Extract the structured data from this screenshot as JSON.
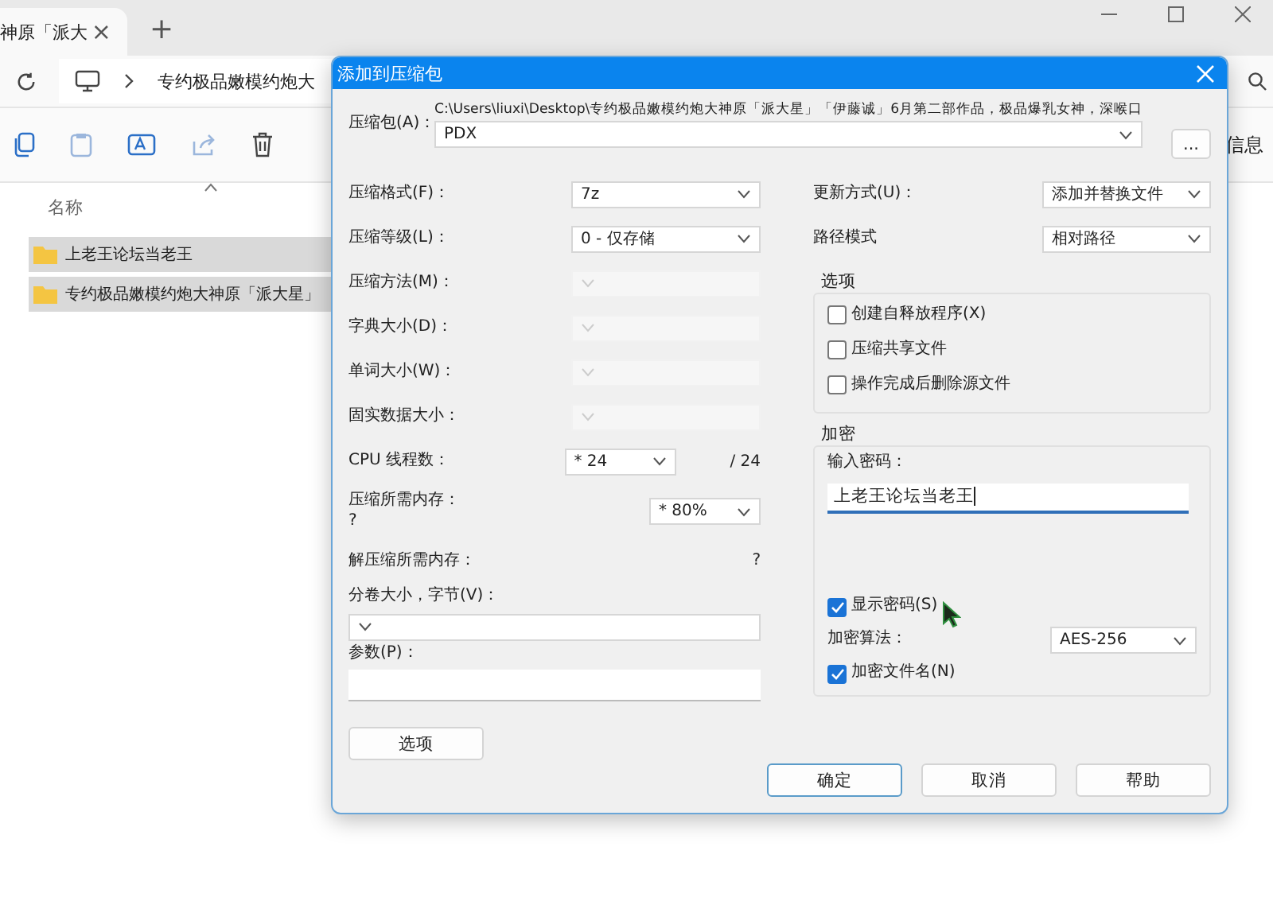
{
  "explorer": {
    "tab": {
      "title": "神原「派大",
      "close": "×"
    },
    "new_tab": "+",
    "address_path": "专约极品嫩模约炮大",
    "side_label": "信息",
    "list": {
      "header": "名称",
      "rows": [
        {
          "name": "上老王论坛当老王",
          "selected": true
        },
        {
          "name": "专约极品嫩模约炮大神原「派大星」",
          "selected": true
        }
      ]
    }
  },
  "dialog": {
    "title": "添加到压缩包",
    "archive": {
      "label": "压缩包(A)：",
      "path": "C:\\Users\\liuxi\\Desktop\\专约极品嫩模约炮大神原「派大星」「伊藤诚」6月第二部作品，极品爆乳女神，深喉口",
      "name": "PDX",
      "browse": "..."
    },
    "left_fields": [
      {
        "kind": "combo",
        "label": "压缩格式(F)：",
        "value": "7z",
        "disabled": false
      },
      {
        "kind": "combo",
        "label": "压缩等级(L)：",
        "value": "0 - 仅存储",
        "disabled": false
      },
      {
        "kind": "combo",
        "label": "压缩方法(M)：",
        "disabled": true
      },
      {
        "kind": "combo",
        "label": "字典大小(D)：",
        "disabled": true
      },
      {
        "kind": "combo",
        "label": "单词大小(W)：",
        "disabled": true
      },
      {
        "kind": "combo",
        "label": "固实数据大小：",
        "disabled": true
      },
      {
        "kind": "threads",
        "label": "CPU 线程数：",
        "value": "* 24",
        "suffix": "/ 24"
      },
      {
        "kind": "memory",
        "label": "压缩所需内存：",
        "note": "?",
        "value": "* 80%"
      },
      {
        "kind": "info",
        "label": "解压缩所需内存：",
        "value": "?"
      },
      {
        "kind": "stacked_combo",
        "label": "分卷大小，字节(V)："
      },
      {
        "kind": "stacked_text",
        "label": "参数(P)："
      }
    ],
    "options_button": "选项",
    "right_fields": [
      {
        "label": "更新方式(U)：",
        "value": "添加并替换文件"
      },
      {
        "label": "路径模式",
        "value": "相对路径"
      }
    ],
    "options_group": {
      "title": "选项",
      "items": [
        {
          "label": "创建自释放程序(X)",
          "checked": false
        },
        {
          "label": "压缩共享文件",
          "checked": false
        },
        {
          "label": "操作完成后删除源文件",
          "checked": false
        }
      ]
    },
    "encryption": {
      "title": "加密",
      "password_label": "输入密码：",
      "password": "上老王论坛当老王",
      "show_password": {
        "label": "显示密码(S)",
        "checked": true
      },
      "method": {
        "label": "加密算法：",
        "value": "AES-256"
      },
      "encrypt_names": {
        "label": "加密文件名(N)",
        "checked": true
      }
    },
    "buttons": [
      {
        "label": "确定",
        "default": true
      },
      {
        "label": "取消",
        "default": false
      },
      {
        "label": "帮助",
        "default": false
      }
    ]
  }
}
